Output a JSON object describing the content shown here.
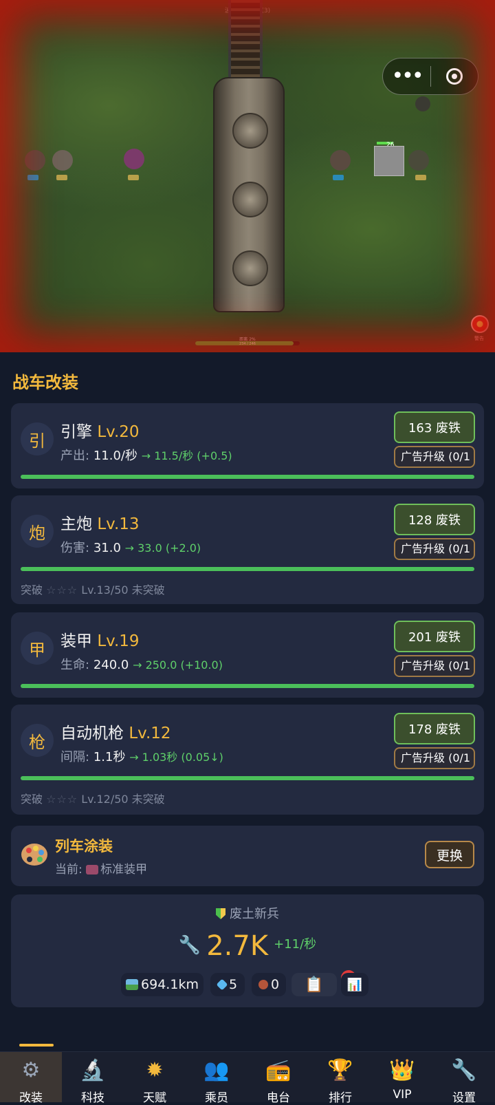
{
  "scene": {
    "top_text": "波数 障碍5-1(3)",
    "progress_label": "距离 2%",
    "progress_value": "234 / 246",
    "supply_count": "26",
    "alert_label": "警告"
  },
  "header": {
    "title": "战车改装"
  },
  "upgrades": [
    {
      "badge": "引",
      "name": "引擎",
      "level": "Lv.20",
      "stat_label": "产出:",
      "stat_value": "11.0/秒",
      "stat_next": "→ 11.5/秒 (+0.5)",
      "cost": "163 废铁",
      "ad_label": "广告升级 (0/1"
    },
    {
      "badge": "炮",
      "name": "主炮",
      "level": "Lv.13",
      "stat_label": "伤害:",
      "stat_value": "31.0",
      "stat_next": "→ 33.0 (+2.0)",
      "cost": "128 废铁",
      "ad_label": "广告升级 (0/1",
      "breakthrough": {
        "label": "突破",
        "stars": "☆☆☆",
        "progress": "Lv.13/50 未突破"
      }
    },
    {
      "badge": "甲",
      "name": "装甲",
      "level": "Lv.19",
      "stat_label": "生命:",
      "stat_value": "240.0",
      "stat_next": "→ 250.0 (+10.0)",
      "cost": "201 废铁",
      "ad_label": "广告升级 (0/1"
    },
    {
      "badge": "枪",
      "name": "自动机枪",
      "level": "Lv.12",
      "stat_label": "间隔:",
      "stat_value": "1.1秒",
      "stat_next": "→ 1.03秒 (0.05↓)",
      "cost": "178 废铁",
      "ad_label": "广告升级 (0/1",
      "breakthrough": {
        "label": "突破",
        "stars": "☆☆☆",
        "progress": "Lv.12/50 未突破"
      }
    }
  ],
  "skin": {
    "title": "列车涂装",
    "current_prefix": "当前:",
    "current_name": "标准装甲",
    "button": "更换"
  },
  "profile": {
    "rank": "废土新兵",
    "scrap": "2.7K",
    "rate": "+11/秒",
    "distance": "694.1km",
    "gems": "5",
    "tokens": "0",
    "task_badge": "2"
  },
  "nav": [
    {
      "label": "改装",
      "icon": "gear-icon",
      "active": true
    },
    {
      "label": "科技",
      "icon": "microscope-icon"
    },
    {
      "label": "天赋",
      "icon": "sun-icon"
    },
    {
      "label": "乘员",
      "icon": "people-icon"
    },
    {
      "label": "电台",
      "icon": "radio-icon"
    },
    {
      "label": "排行",
      "icon": "trophy-icon"
    },
    {
      "label": "VIP",
      "icon": "crown-icon"
    },
    {
      "label": "设置",
      "icon": "wrench-icon"
    }
  ],
  "colors": {
    "accent": "#f3b93d",
    "positive": "#5fd06a",
    "card": "#232a40",
    "background": "#131a2a"
  }
}
